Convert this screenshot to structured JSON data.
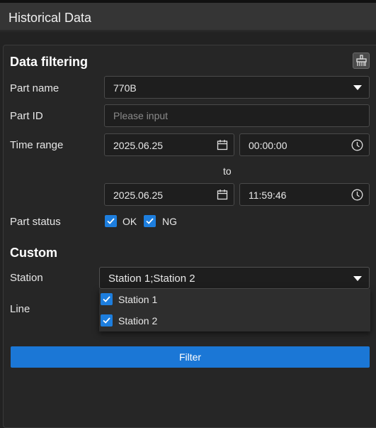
{
  "window": {
    "title": "Historical Data"
  },
  "filtering": {
    "title": "Data filtering",
    "clear_icon": "broom-icon",
    "part_name": {
      "label": "Part name",
      "value": "770B"
    },
    "part_id": {
      "label": "Part ID",
      "placeholder": "Please input"
    },
    "time_range": {
      "label": "Time range",
      "start_date": "2025.06.25",
      "start_time": "00:00:00",
      "separator": "to",
      "end_date": "2025.06.25",
      "end_time": "11:59:46"
    },
    "part_status": {
      "label": "Part status",
      "options": [
        {
          "label": "OK",
          "checked": true
        },
        {
          "label": "NG",
          "checked": true
        }
      ]
    }
  },
  "custom": {
    "title": "Custom",
    "station": {
      "label": "Station",
      "value": "Station 1;Station 2",
      "options": [
        {
          "label": "Station 1",
          "checked": true
        },
        {
          "label": "Station 2",
          "checked": true
        }
      ]
    },
    "line": {
      "label": "Line"
    }
  },
  "actions": {
    "filter_label": "Filter"
  },
  "colors": {
    "accent": "#1b77d6",
    "checkbox": "#1d7ede",
    "background": "#222222"
  }
}
